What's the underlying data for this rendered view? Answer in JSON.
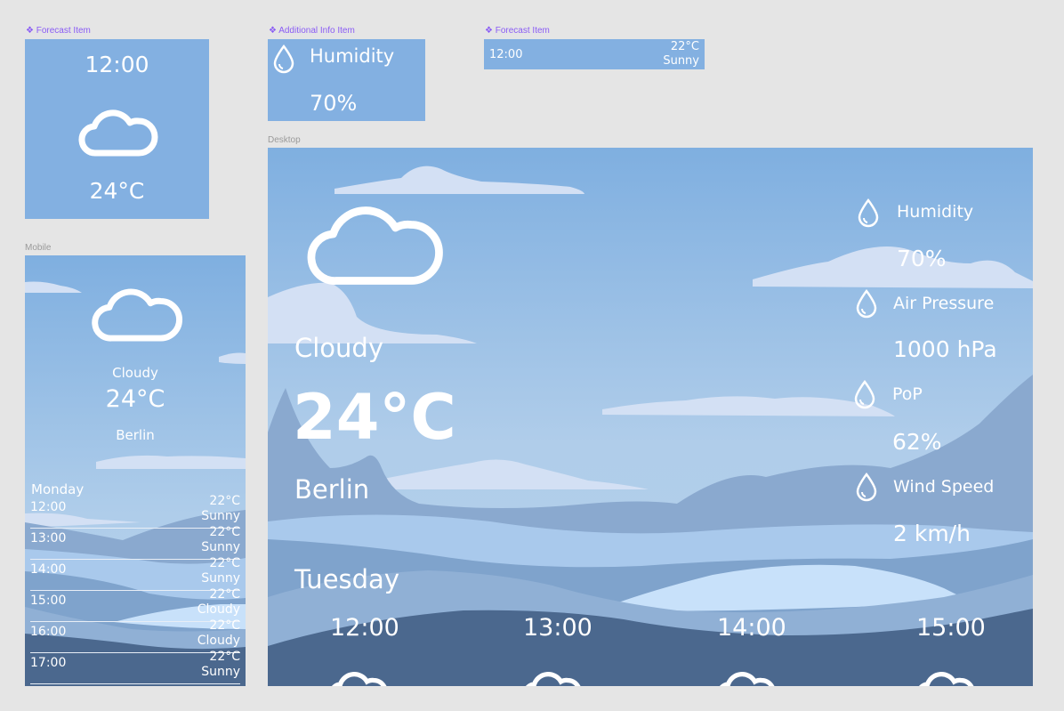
{
  "labels": {
    "forecast_item_1": "❖ Forecast Item",
    "additional_info_item": "❖ Additional Info Item",
    "forecast_item_2": "❖ Forecast Item",
    "mobile": "Mobile",
    "desktop": "Desktop"
  },
  "forecast_item_large": {
    "time": "12:00",
    "icon": "cloud-icon",
    "temp": "24°C"
  },
  "additional_info_item": {
    "icon": "droplet-icon",
    "label": "Humidity",
    "value": "70%"
  },
  "forecast_item_small": {
    "time": "12:00",
    "temp": "22°C",
    "condition": "Sunny"
  },
  "mobile": {
    "icon": "cloud-icon",
    "condition": "Cloudy",
    "temperature": "24°C",
    "city": "Berlin",
    "day": "Monday",
    "hours": [
      {
        "time": "12:00",
        "temp": "22°C",
        "condition": "Sunny"
      },
      {
        "time": "13:00",
        "temp": "22°C",
        "condition": "Sunny"
      },
      {
        "time": "14:00",
        "temp": "22°C",
        "condition": "Sunny"
      },
      {
        "time": "15:00",
        "temp": "22°C",
        "condition": "Cloudy"
      },
      {
        "time": "16:00",
        "temp": "22°C",
        "condition": "Cloudy"
      },
      {
        "time": "17:00",
        "temp": "22°C",
        "condition": "Sunny"
      }
    ]
  },
  "desktop": {
    "icon": "cloud-icon",
    "condition": "Cloudy",
    "temperature": "24°C",
    "city": "Berlin",
    "day": "Tuesday",
    "info": [
      {
        "icon": "droplet-icon",
        "label": "Humidity",
        "value": "70%"
      },
      {
        "icon": "droplet-icon",
        "label": "Air Pressure",
        "value": "1000 hPa"
      },
      {
        "icon": "droplet-icon",
        "label": "PoP",
        "value": "62%"
      },
      {
        "icon": "droplet-icon",
        "label": "Wind Speed",
        "value": "2 km/h"
      }
    ],
    "hours": [
      "12:00",
      "13:00",
      "14:00",
      "15:00"
    ]
  },
  "colors": {
    "sky_top": "#7fafe0",
    "sky_bottom": "#b3d0ea",
    "cloud": "#d3e0f4",
    "mountain": "#8aa9cf",
    "wave_light": "#a9c9ec",
    "wave_mid": "#7fa3cc",
    "wave_bright": "#c8e1fa",
    "wave_dark": "#4b688e",
    "purple_label": "#8a5cf5"
  }
}
